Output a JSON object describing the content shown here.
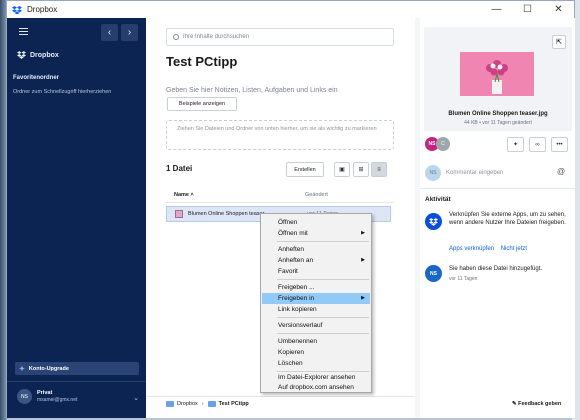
{
  "window": {
    "title": "Dropbox",
    "controls": [
      "—",
      "☐",
      "✕"
    ]
  },
  "sidebar": {
    "logo_text": "Dropbox",
    "section_title": "Favoritenordner",
    "section_hint": "Ordner zum Schnellzugriff hierherziehen",
    "upgrade_label": "Konto-Upgrade",
    "account": {
      "initials": "NS",
      "name": "Privat",
      "email": "msamei@gmx.net"
    }
  },
  "main": {
    "search_placeholder": "Ihre Inhalte durchsuchen",
    "page_title": "Test PCtipp",
    "notes_placeholder": "Geben Sie hier Notizen, Listen, Aufgaben und Links ein",
    "examples_button": "Beispiele anzeigen",
    "dropzone_text": "Ziehen Sie Dateien und Ordner von unten hierher, um sie als wichtig zu markieren",
    "file_count": "1 Datei",
    "create_button": "Erstellen",
    "columns": {
      "name": "Name",
      "changed": "Geändert"
    },
    "file": {
      "name": "Blumen Online Shoppen teaser",
      "date": "vor 11 Tagen"
    },
    "breadcrumb": [
      "Dropbox",
      "Test PCtipp"
    ]
  },
  "context_menu": {
    "items": [
      {
        "label": "Öffnen",
        "submenu": false
      },
      {
        "label": "Öffnen mit",
        "submenu": true
      },
      {
        "label": "Anheften",
        "submenu": false
      },
      {
        "label": "Anheften an",
        "submenu": true
      },
      {
        "label": "Favorit",
        "submenu": false
      },
      {
        "label": "Freigeben ...",
        "submenu": false
      },
      {
        "label": "Freigeben in",
        "submenu": true,
        "highlighted": true
      },
      {
        "label": "Link kopieren",
        "submenu": false
      },
      {
        "label": "Versionsverlauf",
        "submenu": false
      },
      {
        "label": "Umbenennen",
        "submenu": false
      },
      {
        "label": "Kopieren",
        "submenu": false
      },
      {
        "label": "Löschen",
        "submenu": false
      },
      {
        "label": "Im Datei-Explorer ansehen",
        "submenu": false
      },
      {
        "label": "Auf dropbox.com ansehen",
        "submenu": false
      }
    ]
  },
  "right_panel": {
    "file_name": "Blumen Online Shoppen teaser.jpg",
    "file_meta": "44 KB • vor 11 Tagen geändert",
    "share_avatars": [
      "NS",
      "C"
    ],
    "comment_initials": "NS",
    "comment_placeholder": "Kommentar eingeben",
    "activity_title": "Aktivität",
    "activity1_text": "Verknüpfen Sie externe Apps, um zu sehen, wenn andere Nutzer Ihre Dateien freigeben.",
    "activity1_link1": "Apps verknüpfen",
    "activity1_link2": "Nicht jetzt",
    "activity2_initials": "NS",
    "activity2_text": "Sie haben diese Datei hinzugefügt.",
    "activity2_meta": "vor 11 Tagen",
    "feedback": "Feedback geben"
  },
  "colors": {
    "sidebar_bg": "#0c2452",
    "accent": "#0b61d8",
    "menu_highlight": "#91c9f7"
  }
}
